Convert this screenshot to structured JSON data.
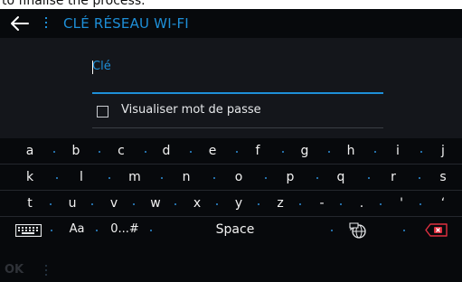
{
  "caption": "to finalise the process.",
  "header": {
    "title": "CLÉ RÉSEAU WI-FI"
  },
  "form": {
    "field_label": "Clé",
    "show_password_label": "Visualiser mot de passe"
  },
  "keyboard": {
    "row1": [
      "a",
      "b",
      "c",
      "d",
      "e",
      "f",
      "g",
      "h",
      "i",
      "j"
    ],
    "row2": [
      "k",
      "l",
      "m",
      "n",
      "o",
      "p",
      "q",
      "r",
      "s"
    ],
    "row3": [
      "t",
      "u",
      "v",
      "w",
      "x",
      "y",
      "z",
      "-",
      ".",
      "'",
      "‘"
    ],
    "row4": {
      "case_label": "Aa",
      "symbols_label": "0...#",
      "space_label": "Space"
    }
  },
  "footer": {
    "ok_label": "OK"
  },
  "colors": {
    "accent": "#1e8fd8",
    "background": "#07090c",
    "panel": "#14161b",
    "backspace": "#e03040"
  }
}
